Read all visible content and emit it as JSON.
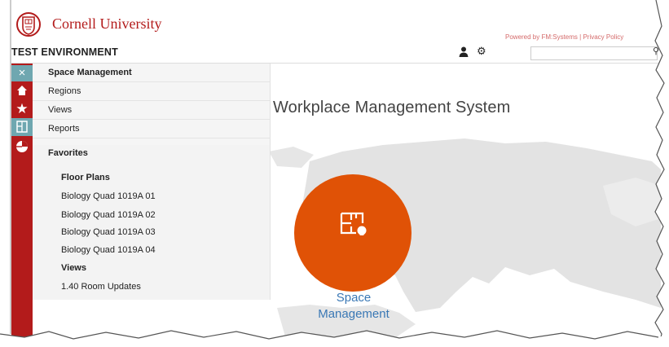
{
  "header": {
    "brand": "Cornell University",
    "environment": "TEST ENVIRONMENT",
    "powered_by": "Powered by FM:Systems | Privacy Policy",
    "search": {
      "value": "",
      "placeholder": ""
    }
  },
  "main": {
    "title": "ated Workplace Management System",
    "tile_label_line1": "Space",
    "tile_label_line2": "Management"
  },
  "rail": {
    "close_glyph": "×",
    "home_glyph": "⌂",
    "star_glyph": "★"
  },
  "menu": {
    "items": [
      {
        "label": "Space Management"
      },
      {
        "label": "Regions"
      },
      {
        "label": "Views"
      },
      {
        "label": "Reports"
      }
    ],
    "favorites_title": "Favorites",
    "floor_plans_heading": "Floor Plans",
    "floor_plans": [
      "Biology Quad 1019A 01",
      "Biology Quad 1019A 02",
      "Biology Quad 1019A 03",
      "Biology Quad 1019A 04"
    ],
    "views_heading": "Views",
    "views": [
      "1.40 Room Updates"
    ]
  },
  "colors": {
    "brand_red": "#b31b1b",
    "rail_teal": "#6fa7b0",
    "tile_orange": "#e05206",
    "link_blue": "#3a78b5"
  },
  "icons": [
    "cornell-seal-icon",
    "user-icon",
    "gear-icon",
    "search-icon",
    "close-icon",
    "home-icon",
    "star-icon",
    "floor-plan-icon",
    "pie-chart-icon",
    "space-management-icon"
  ]
}
